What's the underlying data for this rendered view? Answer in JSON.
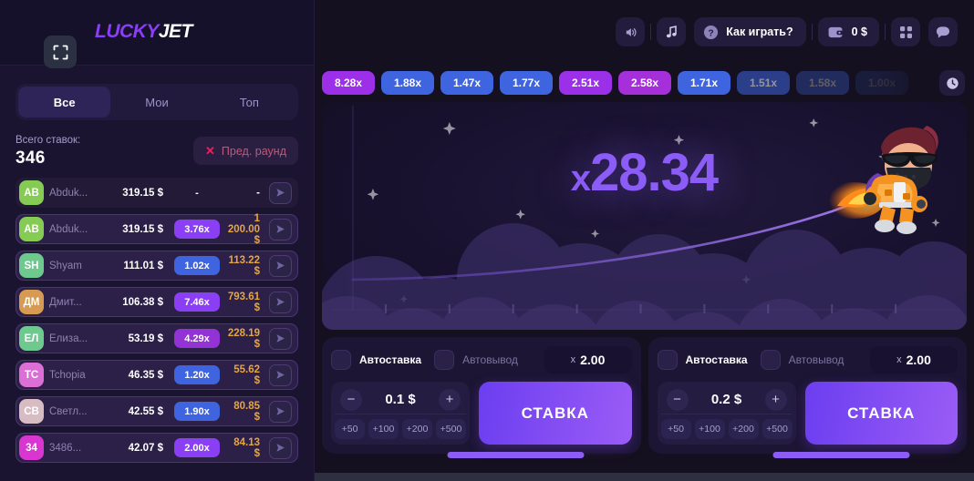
{
  "brand": {
    "logo_primary": "LUCKY",
    "logo_secondary": "JET"
  },
  "sidebar": {
    "fullscreen_icon": "fullscreen-icon",
    "tabs": [
      {
        "label": "Все",
        "active": true
      },
      {
        "label": "Мои",
        "active": false
      },
      {
        "label": "Топ",
        "active": false
      }
    ],
    "total_label": "Всего ставок:",
    "total_value": "346",
    "prev_round_label": "Пред. раунд",
    "prev_round_icon": "close-x-icon",
    "bets": [
      {
        "initials": "AB",
        "avatar_color": "#86cc54",
        "name": "Abduk...",
        "amount": "319.15 $",
        "mult": "-",
        "mult_color": "none",
        "win": "-",
        "pending": true
      },
      {
        "initials": "AB",
        "avatar_color": "#86cc54",
        "name": "Abduk...",
        "amount": "319.15 $",
        "mult": "3.76x",
        "mult_color": "#8b3ff5",
        "win": "1 200.00 $",
        "pending": false
      },
      {
        "initials": "SH",
        "avatar_color": "#6ec98f",
        "name": "Shyam",
        "amount": "111.01 $",
        "mult": "1.02x",
        "mult_color": "#3f64e0",
        "win": "113.22 $",
        "pending": false
      },
      {
        "initials": "ДМ",
        "avatar_color": "#d79a52",
        "name": "Дмит...",
        "amount": "106.38 $",
        "mult": "7.46x",
        "mult_color": "#8b3ff5",
        "win": "793.61 $",
        "pending": false
      },
      {
        "initials": "ЕЛ",
        "avatar_color": "#6ec98f",
        "name": "Елиза...",
        "amount": "53.19 $",
        "mult": "4.29x",
        "mult_color": "#9333d6",
        "win": "228.19 $",
        "pending": false
      },
      {
        "initials": "ТС",
        "avatar_color": "#db6fd6",
        "name": "Tchopia",
        "amount": "46.35 $",
        "mult": "1.20x",
        "mult_color": "#3f64e0",
        "win": "55.62 $",
        "pending": false
      },
      {
        "initials": "СВ",
        "avatar_color": "#d7bcc3",
        "name": "Светл...",
        "amount": "42.55 $",
        "mult": "1.90x",
        "mult_color": "#3f64e0",
        "win": "80.85 $",
        "pending": false
      },
      {
        "initials": "34",
        "avatar_color": "#d935d0",
        "name": "3486...",
        "amount": "42.07 $",
        "mult": "2.00x",
        "mult_color": "#8b3ff5",
        "win": "84.13 $",
        "pending": false
      }
    ]
  },
  "topbar": {
    "sound_icon": "speaker-icon",
    "music_icon": "music-note-icon",
    "how_to_play_label": "Как играть?",
    "how_to_play_icon": "question-mark-icon",
    "wallet_icon": "wallet-icon",
    "balance": "0 $",
    "grid_icon": "grid-apps-icon",
    "chat_icon": "chat-bubble-icon"
  },
  "history": {
    "clock_icon": "clock-history-icon",
    "items": [
      {
        "value": "8.28x",
        "color": "#9b30e8",
        "faded": 0
      },
      {
        "value": "1.88x",
        "color": "#3f64e0",
        "faded": 0
      },
      {
        "value": "1.47x",
        "color": "#3f64e0",
        "faded": 0
      },
      {
        "value": "1.77x",
        "color": "#3f64e0",
        "faded": 0
      },
      {
        "value": "2.51x",
        "color": "#9b30e8",
        "faded": 0
      },
      {
        "value": "2.58x",
        "color": "#a52fd8",
        "faded": 0
      },
      {
        "value": "1.71x",
        "color": "#3f64e0",
        "faded": 0
      },
      {
        "value": "1.51x",
        "color": "#3f64e0",
        "faded": 0.45
      },
      {
        "value": "1.58x",
        "color": "#3f64e0",
        "faded": 0.68
      },
      {
        "value": "1.00x",
        "color": "#3f64e0",
        "faded": 0.85
      }
    ]
  },
  "game": {
    "multiplier_prefix": "x",
    "multiplier_value": "28.34",
    "character_icon": "jetpack-pilot-icon"
  },
  "bet_panels": [
    {
      "auto_bet_label": "Автоставка",
      "auto_bet_checked": false,
      "auto_cashout_label": "Автовывод",
      "auto_cashout_checked": false,
      "auto_x_prefix": "x",
      "auto_x_value": "2.00",
      "minus_label": "−",
      "plus_label": "+",
      "stake": "0.1 $",
      "quick": [
        "+50",
        "+100",
        "+200",
        "+500"
      ],
      "bet_label": "СТАВКА"
    },
    {
      "auto_bet_label": "Автоставка",
      "auto_bet_checked": false,
      "auto_cashout_label": "Автовывод",
      "auto_cashout_checked": false,
      "auto_x_prefix": "x",
      "auto_x_value": "2.00",
      "minus_label": "−",
      "plus_label": "+",
      "stake": "0.2 $",
      "quick": [
        "+50",
        "+100",
        "+200",
        "+500"
      ],
      "bet_label": "СТАВКА"
    }
  ],
  "colors": {
    "accent": "#8b5cf6",
    "bg": "#14101f",
    "sidebar_bg": "#1a1430",
    "gold": "#e7a53b",
    "danger": "#e8245f"
  }
}
